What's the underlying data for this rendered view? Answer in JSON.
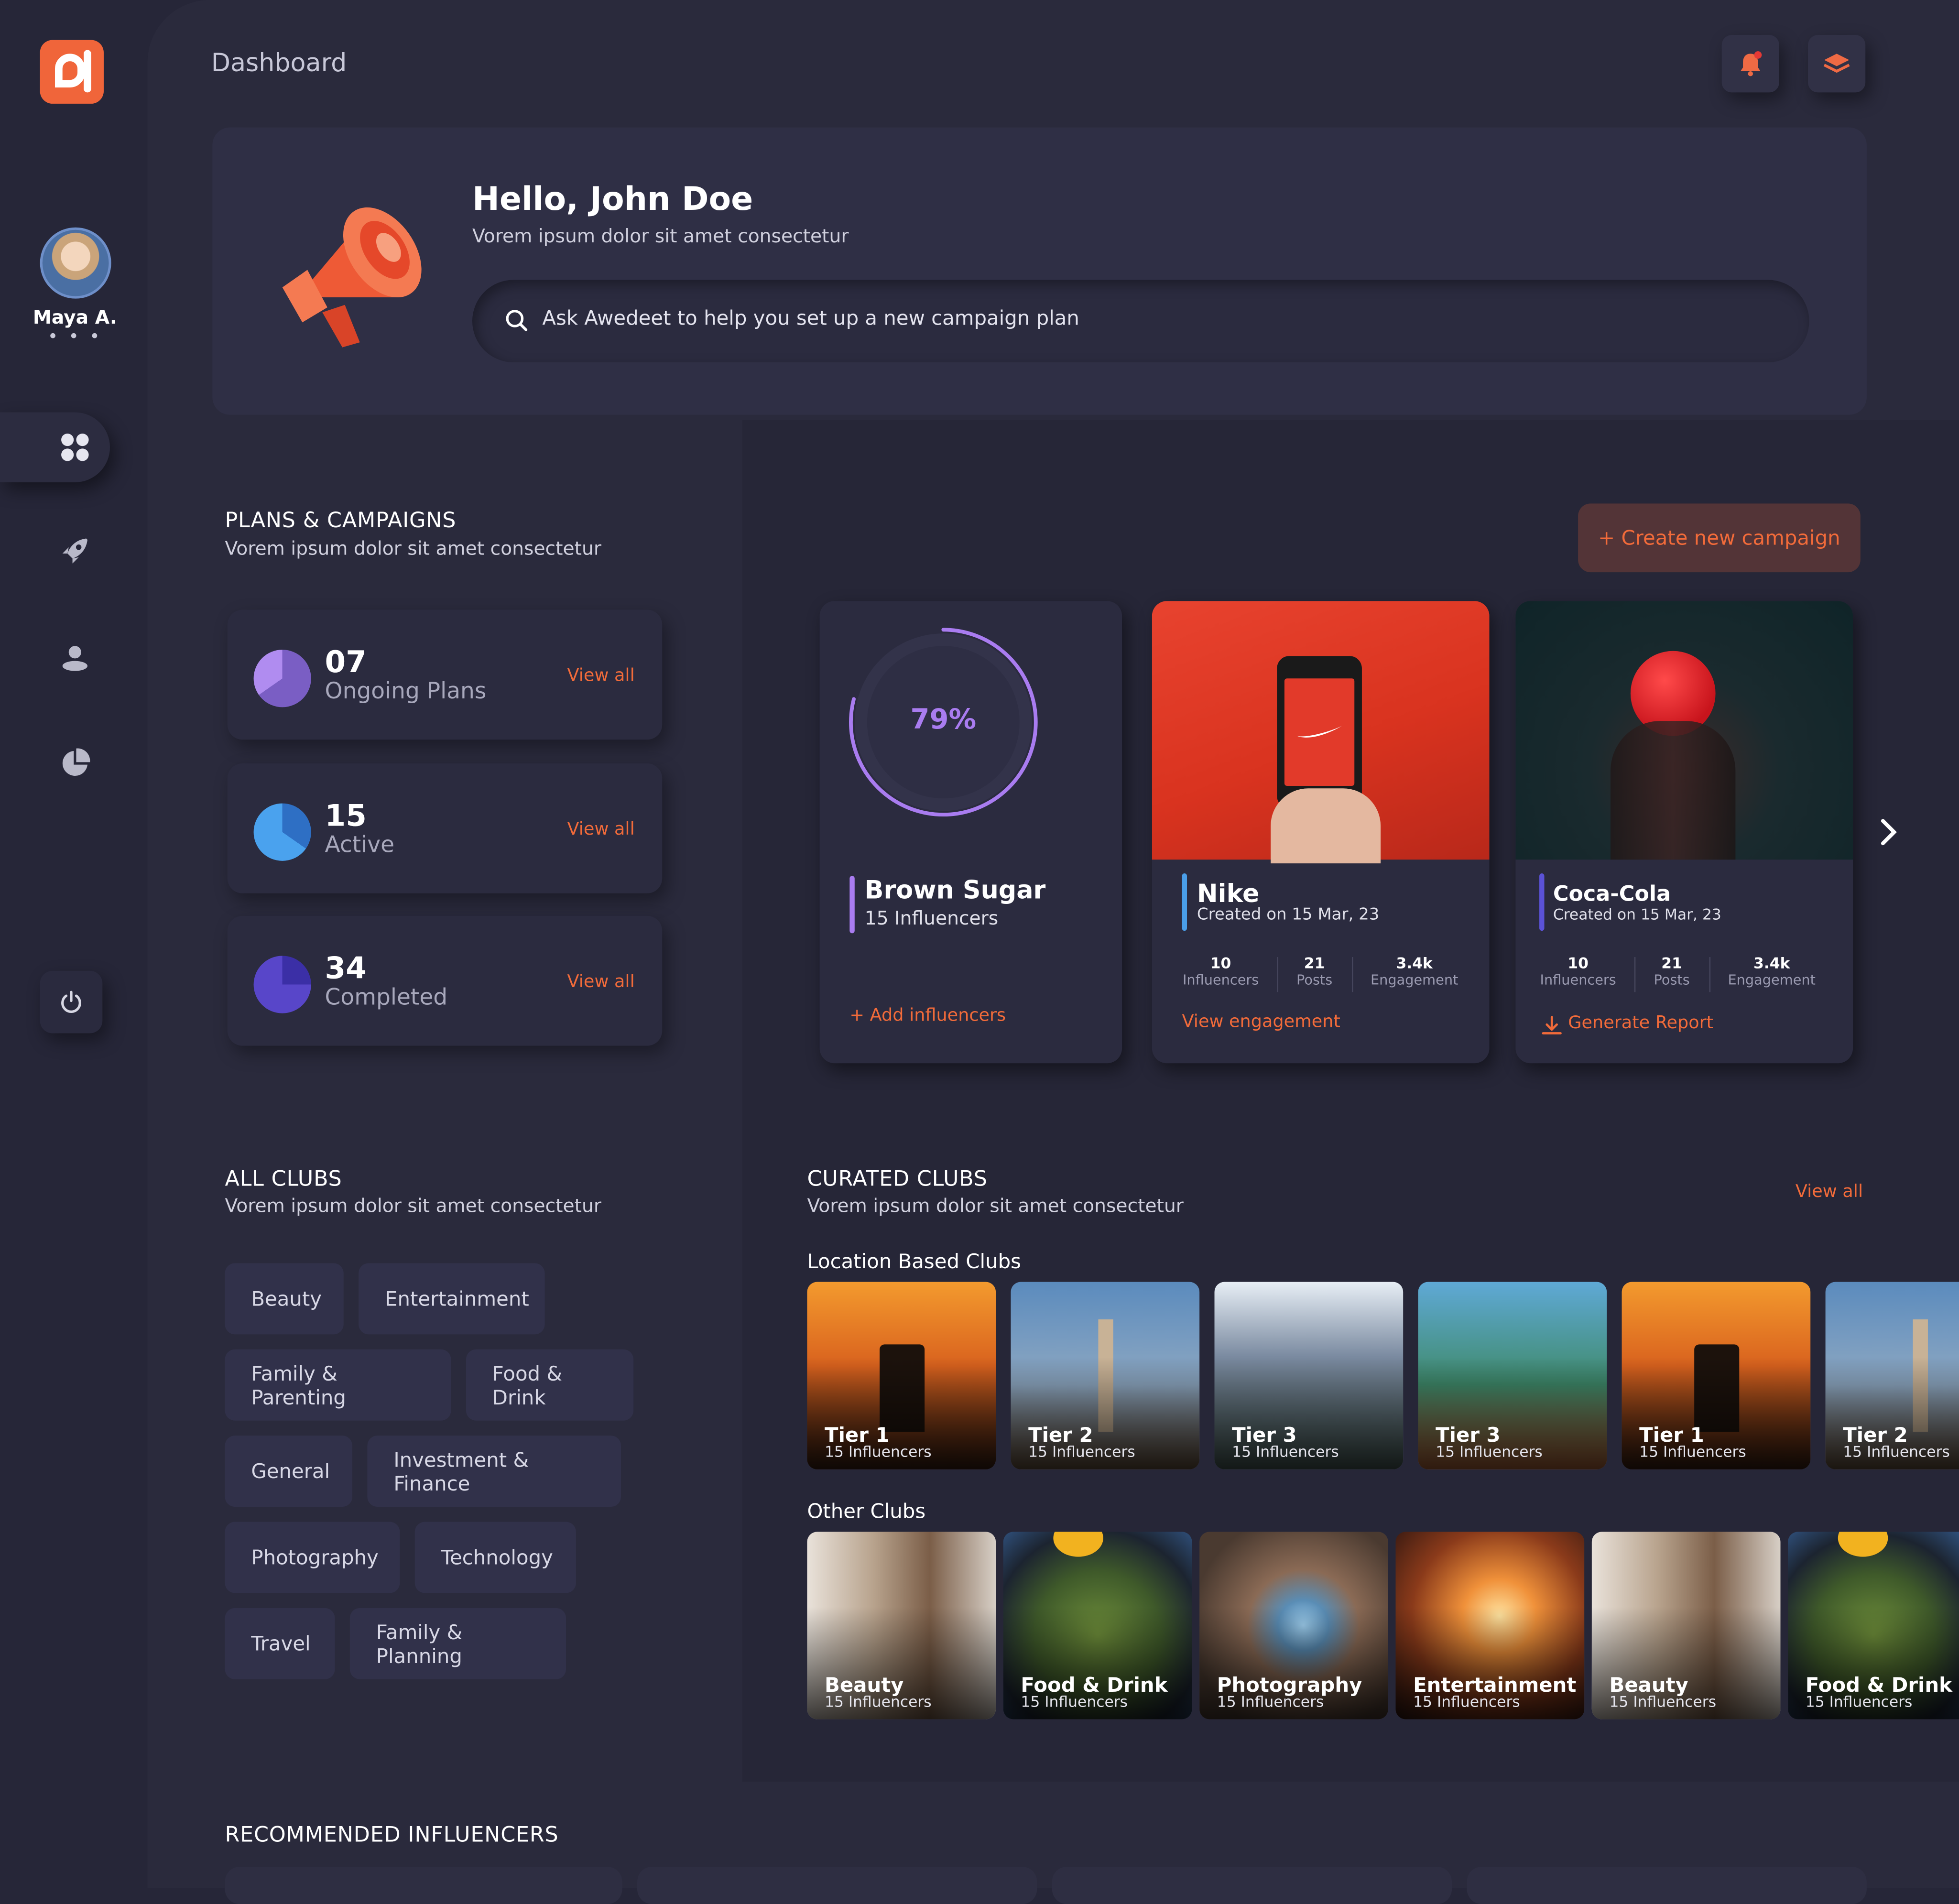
{
  "app": {
    "page_title": "Dashboard",
    "brand_color": "#f0653a",
    "accent_color": "#f26b3a"
  },
  "user": {
    "name": "Maya A.",
    "more": "• • •"
  },
  "hero": {
    "greeting": "Hello, John Doe",
    "subtitle": "Vorem ipsum dolor sit amet consectetur",
    "search_placeholder": "Ask Awedeet to help you set up a new campaign plan"
  },
  "plans": {
    "title": "PLANS & CAMPAIGNS",
    "subtitle": "Vorem ipsum dolor sit amet consectetur",
    "create_label": "+ Create new campaign",
    "stats": [
      {
        "num": "07",
        "label": "Ongoing Plans",
        "link": "View all",
        "color": "#a781e6"
      },
      {
        "num": "15",
        "label": "Active",
        "link": "View all",
        "color": "#4a9ee8"
      },
      {
        "num": "34",
        "label": "Completed",
        "link": "View all",
        "color": "#5846c9"
      }
    ]
  },
  "campaigns": [
    {
      "progress": "79%",
      "title": "Brown Sugar",
      "sub": "15 Influencers",
      "link": "+ Add influencers"
    },
    {
      "title": "Nike",
      "sub": "Created on 15 Mar, 23",
      "metrics": [
        {
          "v": "10",
          "l": "Influencers"
        },
        {
          "v": "21",
          "l": "Posts"
        },
        {
          "v": "3.4k",
          "l": "Engagement"
        }
      ],
      "link": "View engagement"
    },
    {
      "title": "Coca-Cola",
      "sub": "Created on 15 Mar, 23",
      "metrics": [
        {
          "v": "10",
          "l": "Influencers"
        },
        {
          "v": "21",
          "l": "Posts"
        },
        {
          "v": "3.4k",
          "l": "Engagement"
        }
      ],
      "link": "Generate Report"
    }
  ],
  "all_clubs": {
    "title": "ALL CLUBS",
    "subtitle": "Vorem ipsum dolor sit amet consectetur",
    "chips": [
      "Beauty",
      "Entertainment",
      "Family & Parenting",
      "Food & Drink",
      "General",
      "Investment & Finance",
      "Photography",
      "Technology",
      "Travel",
      "Family & Planning"
    ]
  },
  "curated": {
    "title": "CURATED CLUBS",
    "subtitle": "Vorem ipsum dolor sit amet consectetur",
    "view_all": "View all",
    "location_title": "Location Based Clubs",
    "location": [
      {
        "name": "Tier 1",
        "count": "15 Influencers"
      },
      {
        "name": "Tier 2",
        "count": "15 Influencers"
      },
      {
        "name": "Tier 3",
        "count": "15 Influencers"
      },
      {
        "name": "Tier 3",
        "count": "15 Influencers"
      },
      {
        "name": "Tier 1",
        "count": "15 Influencers"
      },
      {
        "name": "Tier 2",
        "count": "15 Influencers"
      }
    ],
    "other_title": "Other Clubs",
    "other": [
      {
        "name": "Beauty",
        "count": "15 Influencers"
      },
      {
        "name": "Food & Drink",
        "count": "15 Influencers"
      },
      {
        "name": "Photography",
        "count": "15 Influencers"
      },
      {
        "name": "Entertainment",
        "count": "15 Influencers"
      },
      {
        "name": "Beauty",
        "count": "15 Influencers"
      },
      {
        "name": "Food & Drink",
        "count": "15 Influencers"
      }
    ]
  },
  "recommended": {
    "title": "RECOMMENDED INFLUENCERS"
  }
}
